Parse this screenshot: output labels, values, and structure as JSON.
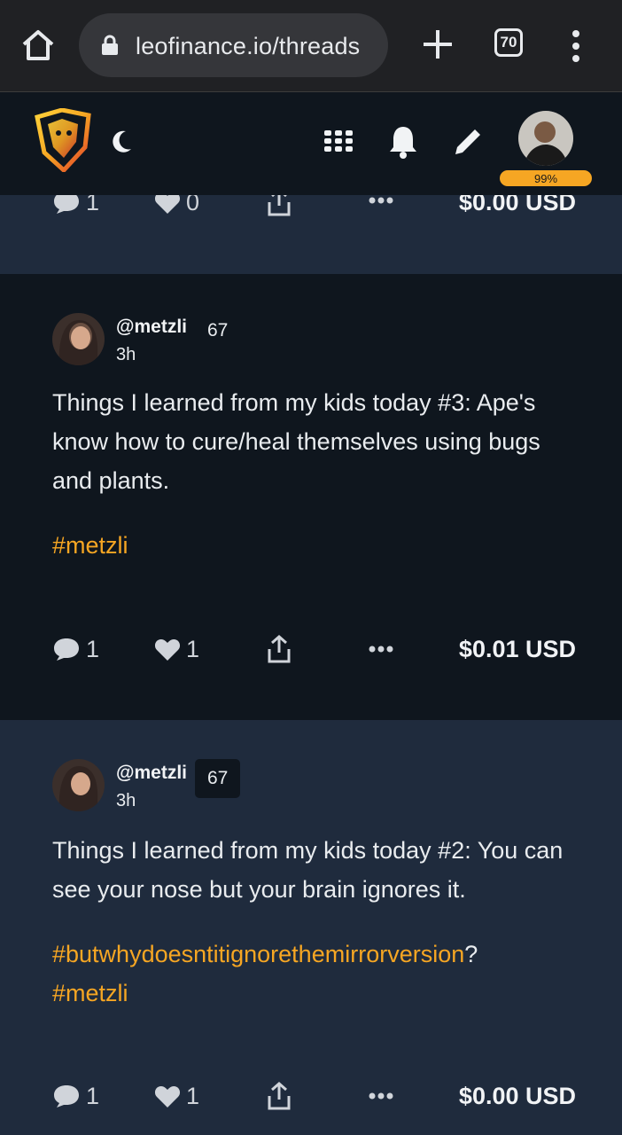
{
  "browser": {
    "url": "leofinance.io/threads",
    "tab_count": "70"
  },
  "header": {
    "avatar_badge": "99%"
  },
  "posts": [
    {
      "comments": "1",
      "likes": "0",
      "price": "$0.00 USD"
    },
    {
      "handle": "@metzli",
      "reputation": "67",
      "time": "3h",
      "text": "Things I learned from my kids today #3: Ape's know how to cure/heal themselves using bugs and plants.",
      "hashtag": "#metzli",
      "comments": "1",
      "likes": "1",
      "price": "$0.01 USD"
    },
    {
      "handle": "@metzli",
      "reputation": "67",
      "time": "3h",
      "text": "Things I learned from my kids today #2: You can see your nose but your brain ignores it.",
      "hashtag1": "#butwhydoesntitignorethemirrorversion",
      "hashtag1_suffix": "?",
      "hashtag2": "#metzli",
      "comments": "1",
      "likes": "1",
      "price": "$0.00 USD"
    }
  ],
  "colors": {
    "accent": "#f6a623",
    "header_bg": "#0f161e",
    "card_dark": "#0f161e",
    "card_light": "#1f2b3d"
  }
}
